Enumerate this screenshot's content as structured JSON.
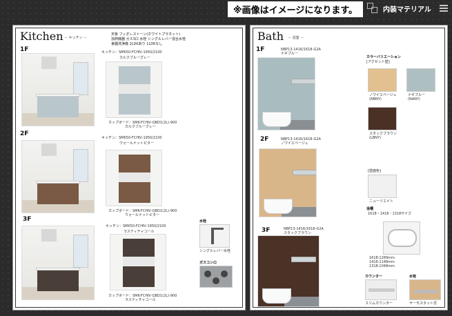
{
  "header": {
    "notice": "※画像はイメージになります。",
    "section_title": "内装マテリアル"
  },
  "kitchen": {
    "title": "Kitchen",
    "subtitle": "－ キッチン －",
    "spec_lines": [
      "天板  フィオレストーン(ホワイトプラネット)",
      "加熱機器  ガス3口  水栓  シングルレバー混合水栓",
      "食器洗浄機  2LDKあり  1LDKなし"
    ],
    "floors": [
      {
        "floor": "1F",
        "model": "キッチン：SMK50-FCHⅣ-1950/2100",
        "color": "カルクブルーグレー",
        "cupboard": "カップボード：SMK-FCHⅣ-QBD1(2L)-900",
        "cupboard_color": "カルクブルーグレー",
        "cabinet_hex": "#b9c6cc"
      },
      {
        "floor": "2F",
        "model": "キッチン：SMK50-FCHⅣ-1950/2100",
        "color": "ウォールナットピター",
        "cupboard": "カップボード：SMK-FCHⅣ-QBD1(2L)-900",
        "cupboard_color": "ウォールナットピター",
        "cabinet_hex": "#7a5a45"
      },
      {
        "floor": "3F",
        "model": "キッチン：SMK50-FCHⅣ-1950/2100",
        "color": "ラスティチャコール",
        "cupboard": "カップボード：SMK-FCHⅣ-QBD1(2L)-900",
        "cupboard_color": "ラスティチャコール",
        "cabinet_hex": "#4a3f38"
      }
    ],
    "faucet_label": "水栓",
    "faucet_caption": "シングルレバー水栓",
    "stove_label": "ガスコンロ"
  },
  "bath": {
    "title": "Bath",
    "subtitle": "－ 浴室 －",
    "floors": [
      {
        "floor": "1F",
        "model": "NBP13-1416/1618-G2A",
        "color": "ナギブルー",
        "wall_hex": "#a9bdc0"
      },
      {
        "floor": "2F",
        "model": "NBP13-1416/1618-G2A",
        "color": "ノワイエベージュ",
        "wall_hex": "#d9b68a"
      },
      {
        "floor": "3F",
        "model": "NBP13-1416/1618-G2A",
        "color": "スタックブラウン",
        "wall_hex": "#4b3226"
      }
    ],
    "color_variation_heading": "カラーバリエーション",
    "accent_panel_heading": "[アクセント壁]",
    "swatches": [
      {
        "name": "ノワイエベージュ",
        "code": "(NBNY)",
        "hex": "#e3c08f"
      },
      {
        "name": "ナギブルー",
        "code": "(NANY)",
        "hex": "#aebfc2"
      },
      {
        "name": "スタックブラウン",
        "code": "(LBNY)",
        "hex": "#4a3025"
      }
    ],
    "main_wall_heading": "[壁面色]",
    "main_wall_name": "ニューリエイト",
    "tub_heading": "浴槽",
    "tub_sizes_label": "1618・1418・1318サイズ",
    "tub_sizes": [
      "1618:1289mm",
      "1416:1148mm",
      "1318:1048mm"
    ],
    "counter_heading": "カウンター",
    "counter_caption": "スリムカウンター",
    "faucet_heading": "水栓",
    "faucet_caption": "サーモスタット式"
  }
}
